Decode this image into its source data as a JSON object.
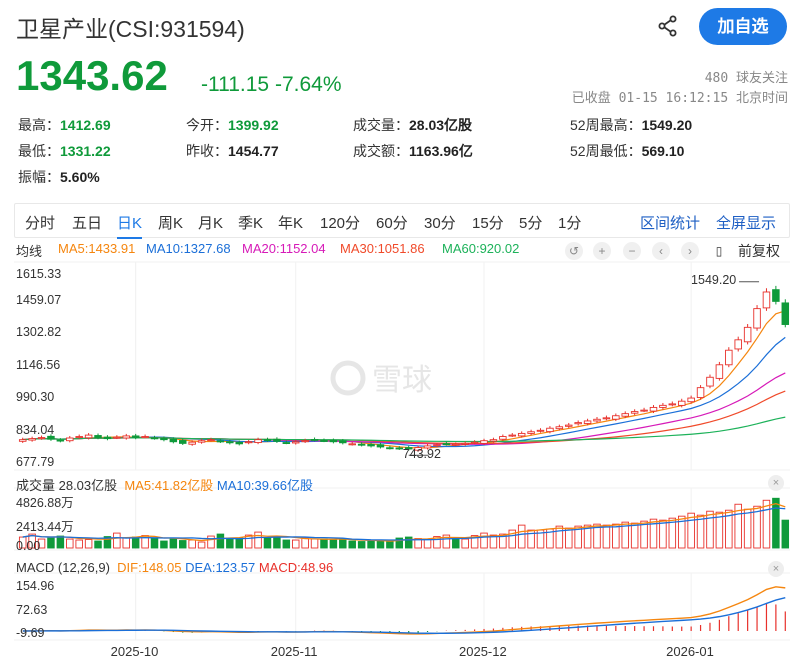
{
  "header": {
    "title": "卫星产业(CSI:931594)",
    "follow_button": "加自选",
    "price": "1343.62",
    "change": "-111.15",
    "change_pct": "-7.64%",
    "followers": "480 球友关注",
    "status": "已收盘 01-15 16:12:15 北京时间"
  },
  "stats": [
    {
      "label": "最高：",
      "value": "1412.69",
      "color": "green"
    },
    {
      "label": "今开：",
      "value": "1399.92",
      "color": "green"
    },
    {
      "label": "成交量：",
      "value": "28.03亿股",
      "color": "normal"
    },
    {
      "label": "52周最高：",
      "value": "1549.20",
      "color": "normal"
    },
    {
      "label": "最低：",
      "value": "1331.22",
      "color": "green"
    },
    {
      "label": "昨收：",
      "value": "1454.77",
      "color": "normal"
    },
    {
      "label": "成交额：",
      "value": "1163.96亿",
      "color": "normal"
    },
    {
      "label": "52周最低：",
      "value": "569.10",
      "color": "normal"
    },
    {
      "label": "振幅：",
      "value": "5.60%",
      "color": "normal"
    }
  ],
  "tabs": [
    "分时",
    "五日",
    "日K",
    "周K",
    "月K",
    "季K",
    "年K",
    "120分",
    "60分",
    "30分",
    "15分",
    "5分",
    "1分"
  ],
  "active_tab": "日K",
  "tab_links": [
    "区间统计",
    "全屏显示"
  ],
  "ma_legend": {
    "label": "均线",
    "items": [
      {
        "text": "MA5:1433.91",
        "color": "#f5860f"
      },
      {
        "text": "MA10:1327.68",
        "color": "#1b6fd8"
      },
      {
        "text": "MA20:1152.04",
        "color": "#d61ab8"
      },
      {
        "text": "MA30:1051.86",
        "color": "#f04a2a"
      },
      {
        "text": "MA60:920.02",
        "color": "#1db25a"
      }
    ],
    "adjust": "前复权"
  },
  "volume_legend": {
    "label": "成交量 28.03亿股",
    "ma5": "MA5:41.82亿股",
    "ma10": "MA10:39.66亿股"
  },
  "macd_legend": {
    "label": "MACD (12,26,9)",
    "dif": "DIF:148.05",
    "dea": "DEA:123.57",
    "macd": "MACD:48.96"
  },
  "colors": {
    "up": "#e8312b",
    "down": "#0f9a3a",
    "accent": "#1e7ae6"
  },
  "chart_data": {
    "type": "candlestick",
    "price_axis": {
      "ticks": [
        "1615.33",
        "1459.07",
        "1302.82",
        "1146.56",
        "990.30",
        "834.04",
        "677.79"
      ],
      "range": [
        677.79,
        1615.33
      ]
    },
    "annotations": {
      "high": "1549.20",
      "low": "743.92"
    },
    "volume_axis": {
      "ticks": [
        "4826.88万",
        "2413.44万",
        "0.00"
      ],
      "range": [
        0,
        4826.88
      ]
    },
    "macd_axis": {
      "ticks": [
        "154.96",
        "72.63",
        "-9.69"
      ],
      "range": [
        -12,
        162
      ]
    },
    "x_labels": [
      {
        "label": "2025-10",
        "index": 12
      },
      {
        "label": "2025-11",
        "index": 29
      },
      {
        "label": "2025-12",
        "index": 49
      },
      {
        "label": "2026-01",
        "index": 71
      }
    ],
    "closes": [
      790,
      795,
      800,
      792,
      785,
      798,
      805,
      812,
      800,
      795,
      802,
      808,
      800,
      805,
      798,
      790,
      780,
      772,
      778,
      785,
      790,
      782,
      775,
      770,
      780,
      790,
      788,
      782,
      776,
      780,
      785,
      790,
      786,
      780,
      775,
      770,
      765,
      760,
      755,
      750,
      748,
      745,
      752,
      760,
      765,
      770,
      768,
      772,
      778,
      785,
      790,
      805,
      812,
      820,
      828,
      835,
      845,
      852,
      860,
      872,
      880,
      888,
      895,
      905,
      915,
      925,
      932,
      945,
      955,
      962,
      975,
      990,
      1040,
      1090,
      1150,
      1220,
      1270,
      1330,
      1420,
      1500,
      1454.77,
      1343.62
    ],
    "volumes": [
      1100,
      1400,
      900,
      1000,
      1200,
      900,
      800,
      850,
      700,
      1150,
      1500,
      1000,
      1100,
      1250,
      1000,
      700,
      900,
      750,
      800,
      600,
      1200,
      1400,
      1000,
      1000,
      1300,
      1600,
      1000,
      1100,
      800,
      800,
      1000,
      900,
      900,
      800,
      950,
      700,
      650,
      750,
      700,
      700,
      1000,
      1100,
      950,
      850,
      1150,
      1300,
      1000,
      900,
      1250,
      1500,
      1300,
      1400,
      1800,
      2300,
      1800,
      1800,
      1900,
      2200,
      2000,
      2200,
      2300,
      2400,
      2300,
      2400,
      2600,
      2500,
      2700,
      2900,
      2800,
      3000,
      3200,
      3500,
      3300,
      3700,
      3600,
      3800,
      4400,
      3900,
      4200,
      4800,
      5000,
      2800
    ]
  }
}
